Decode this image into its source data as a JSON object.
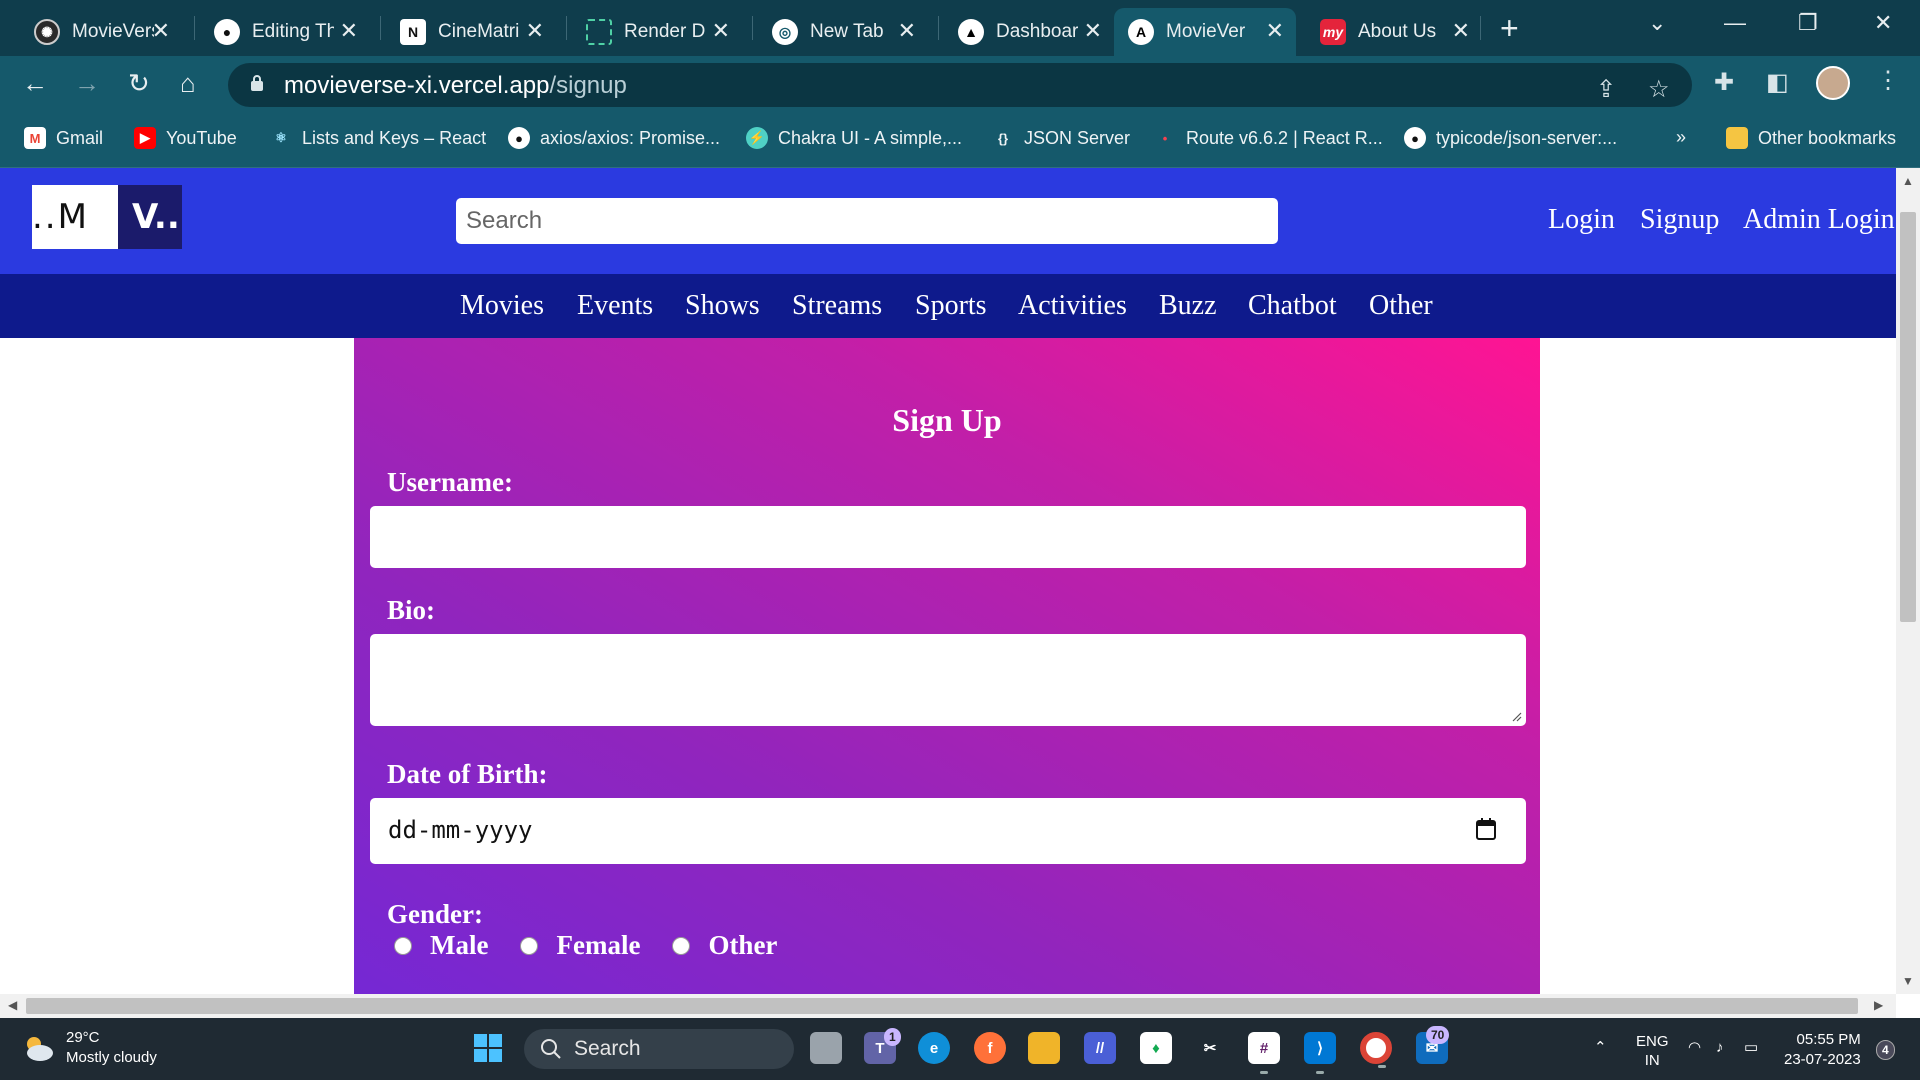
{
  "browser": {
    "tabs": [
      {
        "label": "MovieVerse",
        "icon": "chatgpt-icon",
        "active": false
      },
      {
        "label": "Editing Th",
        "icon": "github-icon",
        "active": false
      },
      {
        "label": "CineMatri",
        "icon": "notion-icon",
        "active": false
      },
      {
        "label": "Render D",
        "icon": "render-icon",
        "active": false
      },
      {
        "label": "New Tab",
        "icon": "chrome-icon",
        "active": false
      },
      {
        "label": "Dashboard",
        "icon": "vercel-icon",
        "active": false
      },
      {
        "label": "MovieVer",
        "icon": "vercel-icon",
        "active": true
      },
      {
        "label": "About Us",
        "icon": "myntra-icon",
        "active": false
      }
    ],
    "address": {
      "host": "movieverse-xi.vercel.app",
      "path": "/signup"
    },
    "bookmarks": [
      {
        "label": "Gmail",
        "icon": "gmail-icon"
      },
      {
        "label": "YouTube",
        "icon": "youtube-icon"
      },
      {
        "label": "Lists and Keys – React",
        "icon": "react-icon"
      },
      {
        "label": "axios/axios: Promise...",
        "icon": "github-icon"
      },
      {
        "label": "Chakra UI - A simple,...",
        "icon": "chakra-icon"
      },
      {
        "label": "JSON Server",
        "icon": "json-server-icon"
      },
      {
        "label": "Route v6.6.2 | React R...",
        "icon": "react-router-icon"
      },
      {
        "label": "typicode/json-server:...",
        "icon": "github-icon"
      }
    ],
    "bookmarks_overflow": "»",
    "other_bookmarks": "Other bookmarks"
  },
  "site": {
    "logo_left": "..M",
    "logo_right": "V..",
    "search_placeholder": "Search",
    "header_links": [
      "Login",
      "Signup",
      "Admin Login"
    ],
    "categories": [
      "Movies",
      "Events",
      "Shows",
      "Streams",
      "Sports",
      "Activities",
      "Buzz",
      "Chatbot",
      "Other"
    ]
  },
  "signup_form": {
    "title": "Sign Up",
    "username_label": "Username:",
    "username_value": "",
    "bio_label": "Bio:",
    "bio_value": "",
    "dob_label": "Date of Birth:",
    "dob_placeholder": "dd-mm-yyyy",
    "gender_label": "Gender:",
    "gender_options": [
      "Male",
      "Female",
      "Other"
    ],
    "colors": {
      "gradient_start": "#ff1493",
      "gradient_end": "#7228d6",
      "header": "#2b3ae0",
      "nav": "#0e1a8c"
    }
  },
  "taskbar": {
    "weather_temp": "29°C",
    "weather_desc": "Mostly cloudy",
    "search_label": "Search",
    "teams_badge": "1",
    "mail_badge": "70",
    "lang_line1": "ENG",
    "lang_line2": "IN",
    "time": "05:55 PM",
    "date": "23-07-2023",
    "notifications": "4"
  }
}
